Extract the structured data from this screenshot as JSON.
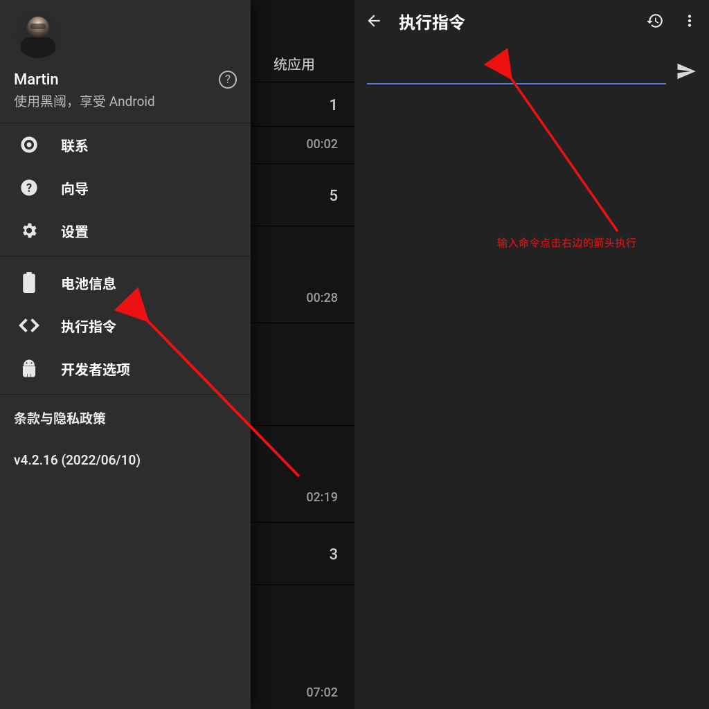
{
  "left": {
    "profile": {
      "name": "Martin",
      "tagline": "使用黑阈，享受 Android"
    },
    "menu": {
      "contact": "联系",
      "wizard": "向导",
      "settings": "设置",
      "battery": "电池信息",
      "exec": "执行指令",
      "devopts": "开发者选项"
    },
    "footer": {
      "terms": "条款与隐私政策",
      "version": "v4.2.16 (2022/06/10)"
    },
    "peek": {
      "tab": "统应用",
      "v1": "1",
      "t1": "00:02",
      "v2": "5",
      "t2": "00:28",
      "t3": "02:19",
      "v3": "3",
      "t4": "07:02"
    }
  },
  "right": {
    "title": "执行指令",
    "command_value": "",
    "annotation": "输入命令点击右边的箭头执行"
  }
}
